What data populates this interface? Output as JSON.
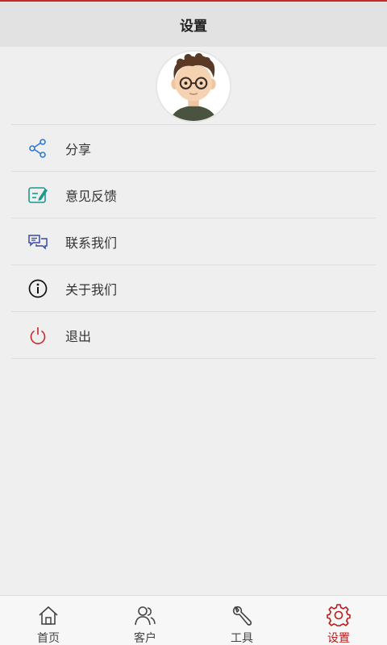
{
  "header": {
    "title": "设置"
  },
  "profile": {
    "avatar_icon": "user-avatar-illustration"
  },
  "menu": {
    "items": [
      {
        "label": "分享",
        "icon": "share-icon",
        "color": "#2b7bd6"
      },
      {
        "label": "意见反馈",
        "icon": "feedback-edit-icon",
        "color": "#1a9a8a"
      },
      {
        "label": "联系我们",
        "icon": "chat-bubbles-icon",
        "color": "#3949ab"
      },
      {
        "label": "关于我们",
        "icon": "info-icon",
        "color": "#111111"
      },
      {
        "label": "退出",
        "icon": "power-icon",
        "color": "#c62828"
      }
    ]
  },
  "tabbar": {
    "tabs": [
      {
        "label": "首页",
        "icon": "home-icon",
        "active": false
      },
      {
        "label": "客户",
        "icon": "customers-icon",
        "active": false
      },
      {
        "label": "工具",
        "icon": "wrench-icon",
        "active": false
      },
      {
        "label": "设置",
        "icon": "gear-icon",
        "active": true
      }
    ]
  },
  "colors": {
    "accent": "#b71c1c",
    "background": "#efefef",
    "header_bg": "#e2e2e2"
  }
}
